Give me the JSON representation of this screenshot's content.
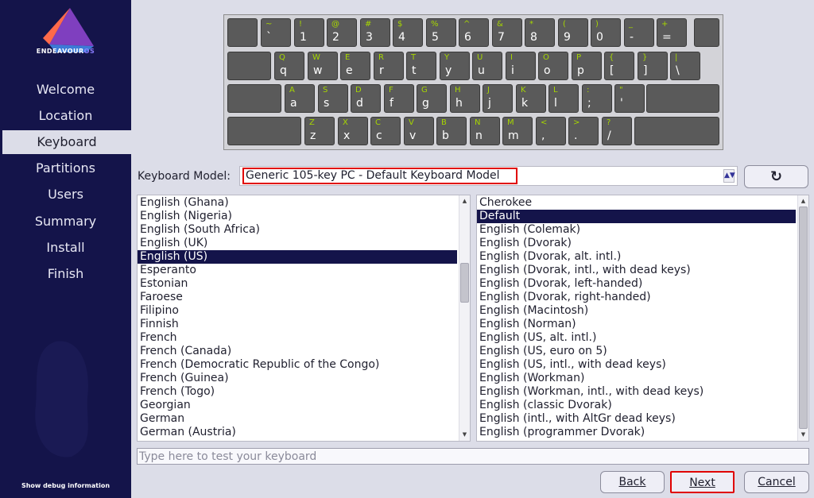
{
  "sidebar": {
    "logo_text": "ENDEAVOUR",
    "logo_text_accent": "OS",
    "items": [
      {
        "label": "Welcome"
      },
      {
        "label": "Location"
      },
      {
        "label": "Keyboard",
        "active": true
      },
      {
        "label": "Partitions"
      },
      {
        "label": "Users"
      },
      {
        "label": "Summary"
      },
      {
        "label": "Install"
      },
      {
        "label": "Finish"
      }
    ],
    "debug_label": "Show debug information"
  },
  "keyboard_rows": [
    [
      [
        "~",
        "`"
      ],
      [
        "!",
        "1"
      ],
      [
        "@",
        "2"
      ],
      [
        "#",
        "3"
      ],
      [
        "$",
        "4"
      ],
      [
        "%",
        "5"
      ],
      [
        "^",
        "6"
      ],
      [
        "&",
        "7"
      ],
      [
        "*",
        "8"
      ],
      [
        "(",
        "9"
      ],
      [
        ")",
        "0"
      ],
      [
        "_",
        "-"
      ],
      [
        "+",
        "="
      ]
    ],
    [
      [
        "Q",
        "q"
      ],
      [
        "W",
        "w"
      ],
      [
        "E",
        "e"
      ],
      [
        "R",
        "r"
      ],
      [
        "T",
        "t"
      ],
      [
        "Y",
        "y"
      ],
      [
        "U",
        "u"
      ],
      [
        "I",
        "i"
      ],
      [
        "O",
        "o"
      ],
      [
        "P",
        "p"
      ],
      [
        "{",
        "["
      ],
      [
        "}",
        "]"
      ],
      [
        "|",
        "\\"
      ]
    ],
    [
      [
        "A",
        "a"
      ],
      [
        "S",
        "s"
      ],
      [
        "D",
        "d"
      ],
      [
        "F",
        "f"
      ],
      [
        "G",
        "g"
      ],
      [
        "H",
        "h"
      ],
      [
        "J",
        "j"
      ],
      [
        "K",
        "k"
      ],
      [
        "L",
        "l"
      ],
      [
        ":",
        ";"
      ],
      [
        "\"",
        "'"
      ]
    ],
    [
      [
        "Z",
        "z"
      ],
      [
        "X",
        "x"
      ],
      [
        "C",
        "c"
      ],
      [
        "V",
        "v"
      ],
      [
        "B",
        "b"
      ],
      [
        "N",
        "n"
      ],
      [
        "M",
        "m"
      ],
      [
        "<",
        ","
      ],
      [
        ">",
        "."
      ],
      [
        "?",
        "/"
      ]
    ]
  ],
  "model": {
    "label": "Keyboard Model:",
    "value": "Generic 105-key PC  -  Default Keyboard Model",
    "reset_icon": "refresh-icon"
  },
  "layouts": [
    {
      "label": "English (Ghana)"
    },
    {
      "label": "English (Nigeria)"
    },
    {
      "label": "English (South Africa)"
    },
    {
      "label": "English (UK)"
    },
    {
      "label": "English (US)",
      "selected": true
    },
    {
      "label": "Esperanto"
    },
    {
      "label": "Estonian"
    },
    {
      "label": "Faroese"
    },
    {
      "label": "Filipino"
    },
    {
      "label": "Finnish"
    },
    {
      "label": "French"
    },
    {
      "label": "French (Canada)"
    },
    {
      "label": "French (Democratic Republic of the Congo)"
    },
    {
      "label": "French (Guinea)"
    },
    {
      "label": "French (Togo)"
    },
    {
      "label": "Georgian"
    },
    {
      "label": "German"
    },
    {
      "label": "German (Austria)"
    }
  ],
  "variants": [
    {
      "label": "Cherokee"
    },
    {
      "label": "Default",
      "selected": true
    },
    {
      "label": "English (Colemak)"
    },
    {
      "label": "English (Dvorak)"
    },
    {
      "label": "English (Dvorak, alt. intl.)"
    },
    {
      "label": "English (Dvorak, intl., with dead keys)"
    },
    {
      "label": "English (Dvorak, left-handed)"
    },
    {
      "label": "English (Dvorak, right-handed)"
    },
    {
      "label": "English (Macintosh)"
    },
    {
      "label": "English (Norman)"
    },
    {
      "label": "English (US, alt. intl.)"
    },
    {
      "label": "English (US, euro on 5)"
    },
    {
      "label": "English (US, intl., with dead keys)"
    },
    {
      "label": "English (Workman)"
    },
    {
      "label": "English (Workman, intl., with dead keys)"
    },
    {
      "label": "English (classic Dvorak)"
    },
    {
      "label": "English (intl., with AltGr dead keys)"
    },
    {
      "label": "English (programmer Dvorak)"
    }
  ],
  "test_input": {
    "placeholder": "Type here to test your keyboard",
    "value": ""
  },
  "buttons": {
    "back": "Back",
    "next": "Next",
    "cancel": "Cancel"
  }
}
